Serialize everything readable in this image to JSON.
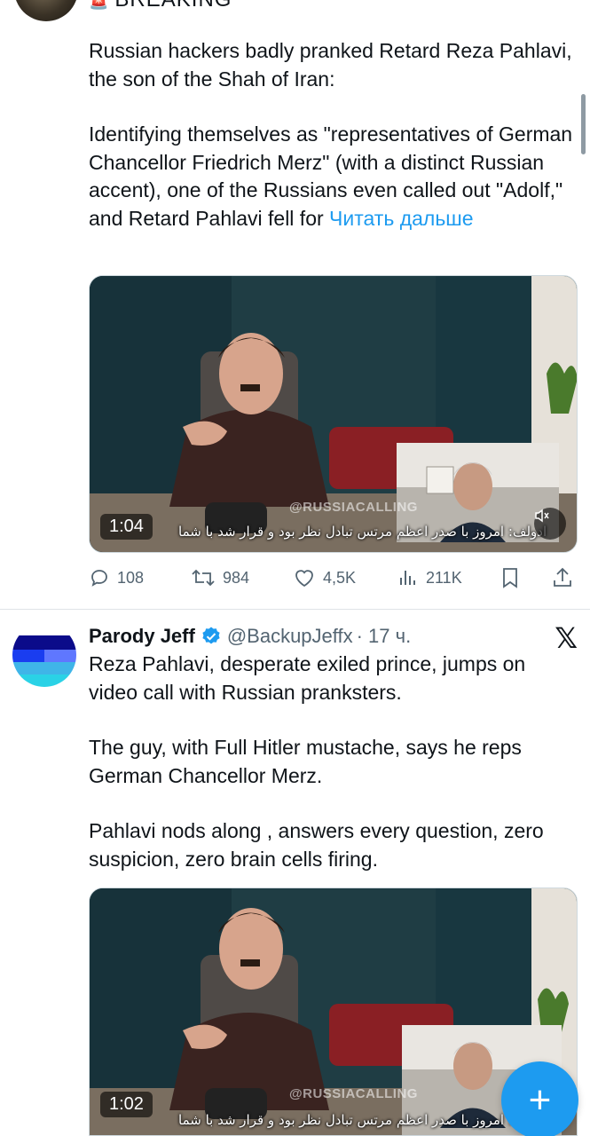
{
  "tweet1": {
    "label": "BREAKING",
    "paragraphs": [
      "Russian hackers badly pranked Retard Reza Pahlavi, the son of the Shah of Iran:",
      "Identifying themselves as \"representatives of German Chancellor Friedrich Merz\" (with a distinct Russian accent), one of the Russians even called out \"Adolf,\" and Retard Pahlavi fell for"
    ],
    "read_more": "Читать дальше",
    "media": {
      "duration": "1:04",
      "watermark": "@RUSSIACALLING",
      "subtitle": "ادولف: امروز با صدر اعظم مرتس تبادل نظر بود و قرار شد با شما"
    },
    "actions": {
      "replies": "108",
      "reposts": "984",
      "likes": "4,5K",
      "views": "211K"
    }
  },
  "tweet2": {
    "name": "Parody Jeff",
    "handle": "@BackupJeffx",
    "time": "· 17 ч.",
    "paragraphs": [
      "Reza Pahlavi, desperate exiled prince, jumps on video call with Russian pranksters.",
      "The guy, with Full Hitler mustache, says he reps German Chancellor Merz.",
      "Pahlavi nods along , answers every question, zero suspicion, zero brain cells firing."
    ],
    "media": {
      "duration": "1:02",
      "watermark": "@RUSSIACALLING",
      "subtitle": "ادولف: امروز با صدر اعظم مرتس تبادل نظر بود و قرار شد با شما"
    }
  },
  "fab": {
    "label": "+"
  },
  "colors": {
    "accent": "#1d9bf0",
    "muted": "#536471",
    "text": "#0f1419"
  }
}
